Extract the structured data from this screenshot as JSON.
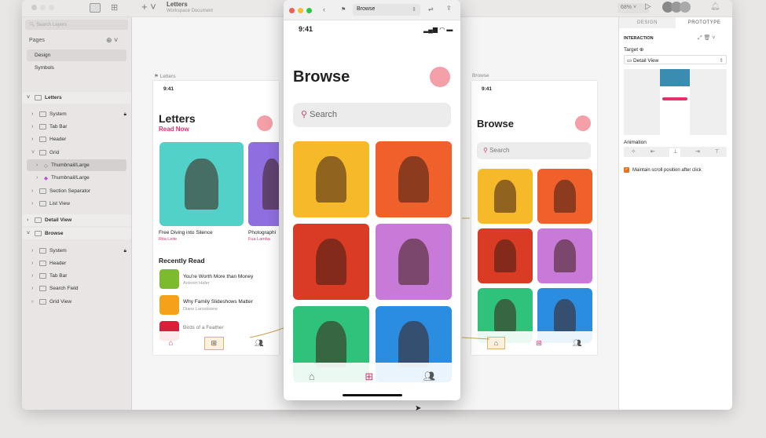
{
  "toolbar": {
    "doc_title": "Letters",
    "doc_subtitle": "Workspace Document",
    "zoom": "68%"
  },
  "sidebar": {
    "search_placeholder": "Search Layers",
    "pages_label": "Pages",
    "pages": [
      "Design",
      "Symbols"
    ],
    "letters": {
      "label": "Letters",
      "children": [
        "System",
        "Tab Bar",
        "Header",
        "Grid",
        "Thumbnail/Large",
        "Thumbnail/Large",
        "Section Separator",
        "List View"
      ]
    },
    "detail": "Detail View",
    "browse": {
      "label": "Browse",
      "children": [
        "System",
        "Header",
        "Tab Bar",
        "Search Field",
        "Grid View"
      ]
    }
  },
  "letters_board": {
    "label": "Letters",
    "time": "9:41",
    "title": "Letters",
    "subtitle": "Read Now",
    "cards": [
      {
        "title": "Free Diving into Silence",
        "author": "Rita Leite"
      },
      {
        "title": "Photographi",
        "author": "Fua Lamba"
      }
    ],
    "recent_title": "Recently Read",
    "recent": [
      {
        "title": "You're Worth More than Money",
        "author": "Antonin Hafer"
      },
      {
        "title": "Why Family Slideshows Matter",
        "author": "Diane Lansdowne"
      },
      {
        "title": "Birds of a Feather",
        "author": ""
      }
    ]
  },
  "preview": {
    "url": "Browse",
    "time": "9:41",
    "title": "Browse",
    "search": "Search"
  },
  "browse_board": {
    "label": "Browse",
    "time": "9:41",
    "title": "Browse",
    "search": "Search"
  },
  "photo_colors": [
    "#f6b92a",
    "#f0602a",
    "#d93b25",
    "#c87ad8",
    "#2fc27a",
    "#2b8de0"
  ],
  "inspector": {
    "tabs": [
      "DESIGN",
      "PROTOTYPE"
    ],
    "interaction": "INTERACTION",
    "target_label": "Target",
    "target_value": "Detail View",
    "animation_label": "Animation",
    "checkbox_label": "Maintain scroll position after click",
    "checkbox_checked": true
  }
}
